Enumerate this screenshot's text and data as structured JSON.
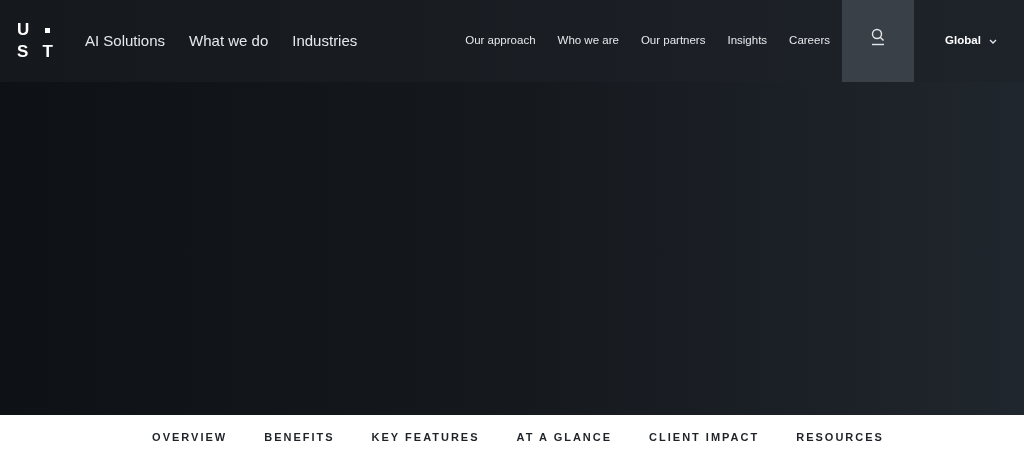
{
  "logo": {
    "letters": [
      "U",
      "S",
      "T"
    ]
  },
  "primary_nav": [
    "AI Solutions",
    "What we do",
    "Industries"
  ],
  "secondary_nav": [
    "Our approach",
    "Who we are",
    "Our partners",
    "Insights",
    "Careers"
  ],
  "search": {
    "selected": true
  },
  "region": {
    "label": "Global"
  },
  "section_tabs": [
    "OVERVIEW",
    "BENEFITS",
    "KEY FEATURES",
    "AT A GLANCE",
    "CLIENT IMPACT",
    "RESOURCES"
  ]
}
